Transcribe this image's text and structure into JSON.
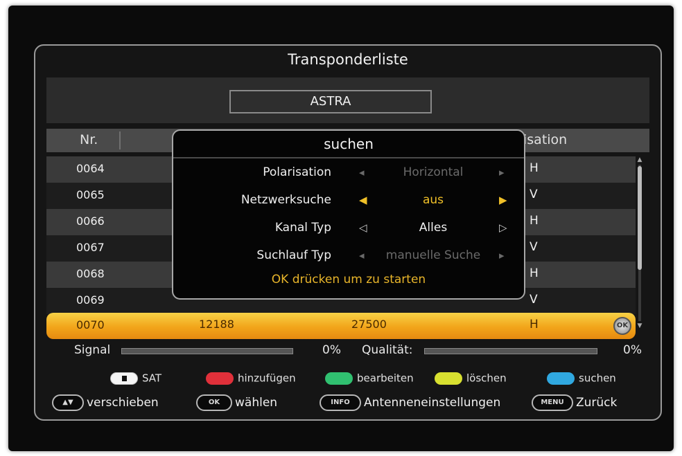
{
  "title": "Transponderliste",
  "satellite": "ASTRA",
  "table": {
    "col_nr": "Nr.",
    "col_pol": "isation",
    "rows": [
      {
        "nr": "0064",
        "freq": "",
        "sr": "",
        "pol": "H"
      },
      {
        "nr": "0065",
        "freq": "",
        "sr": "",
        "pol": "V"
      },
      {
        "nr": "0066",
        "freq": "",
        "sr": "",
        "pol": "H"
      },
      {
        "nr": "0067",
        "freq": "",
        "sr": "",
        "pol": "V"
      },
      {
        "nr": "0068",
        "freq": "",
        "sr": "",
        "pol": "H"
      },
      {
        "nr": "0069",
        "freq": "",
        "sr": "",
        "pol": "V"
      },
      {
        "nr": "0070",
        "freq": "12188",
        "sr": "27500",
        "pol": "H"
      }
    ],
    "selected_index": 6,
    "ok_badge": "OK"
  },
  "dialog": {
    "title": "suchen",
    "options": [
      {
        "label": "Polarisation",
        "value": "Horizontal",
        "state": "disabled"
      },
      {
        "label": "Netzwerksuche",
        "value": "aus",
        "state": "active"
      },
      {
        "label": "Kanal Typ",
        "value": "Alles",
        "state": "normal"
      },
      {
        "label": "Suchlauf Typ",
        "value": "manuelle Suche",
        "state": "disabled"
      }
    ],
    "hint": "OK drücken um zu starten"
  },
  "status": {
    "signal_label": "Signal",
    "signal_value": "0%",
    "quality_label": "Qualität:",
    "quality_value": "0%"
  },
  "legend": {
    "sat": "SAT",
    "red": "hinzufügen",
    "green": "bearbeiten",
    "yellow": "löschen",
    "blue": "suchen"
  },
  "keys": {
    "move_cap": "▲▼",
    "move_label": "verschieben",
    "ok_cap": "OK",
    "ok_label": "wählen",
    "info_cap": "INFO",
    "info_label": "Antenneneinstellungen",
    "menu_cap": "MENU",
    "menu_label": "Zurück"
  },
  "colors": {
    "selection": "#f2a51a",
    "active_option": "#f0c028",
    "red": "#e0303a",
    "green": "#30c070",
    "yellow": "#d8e030",
    "blue": "#30a8e0"
  }
}
